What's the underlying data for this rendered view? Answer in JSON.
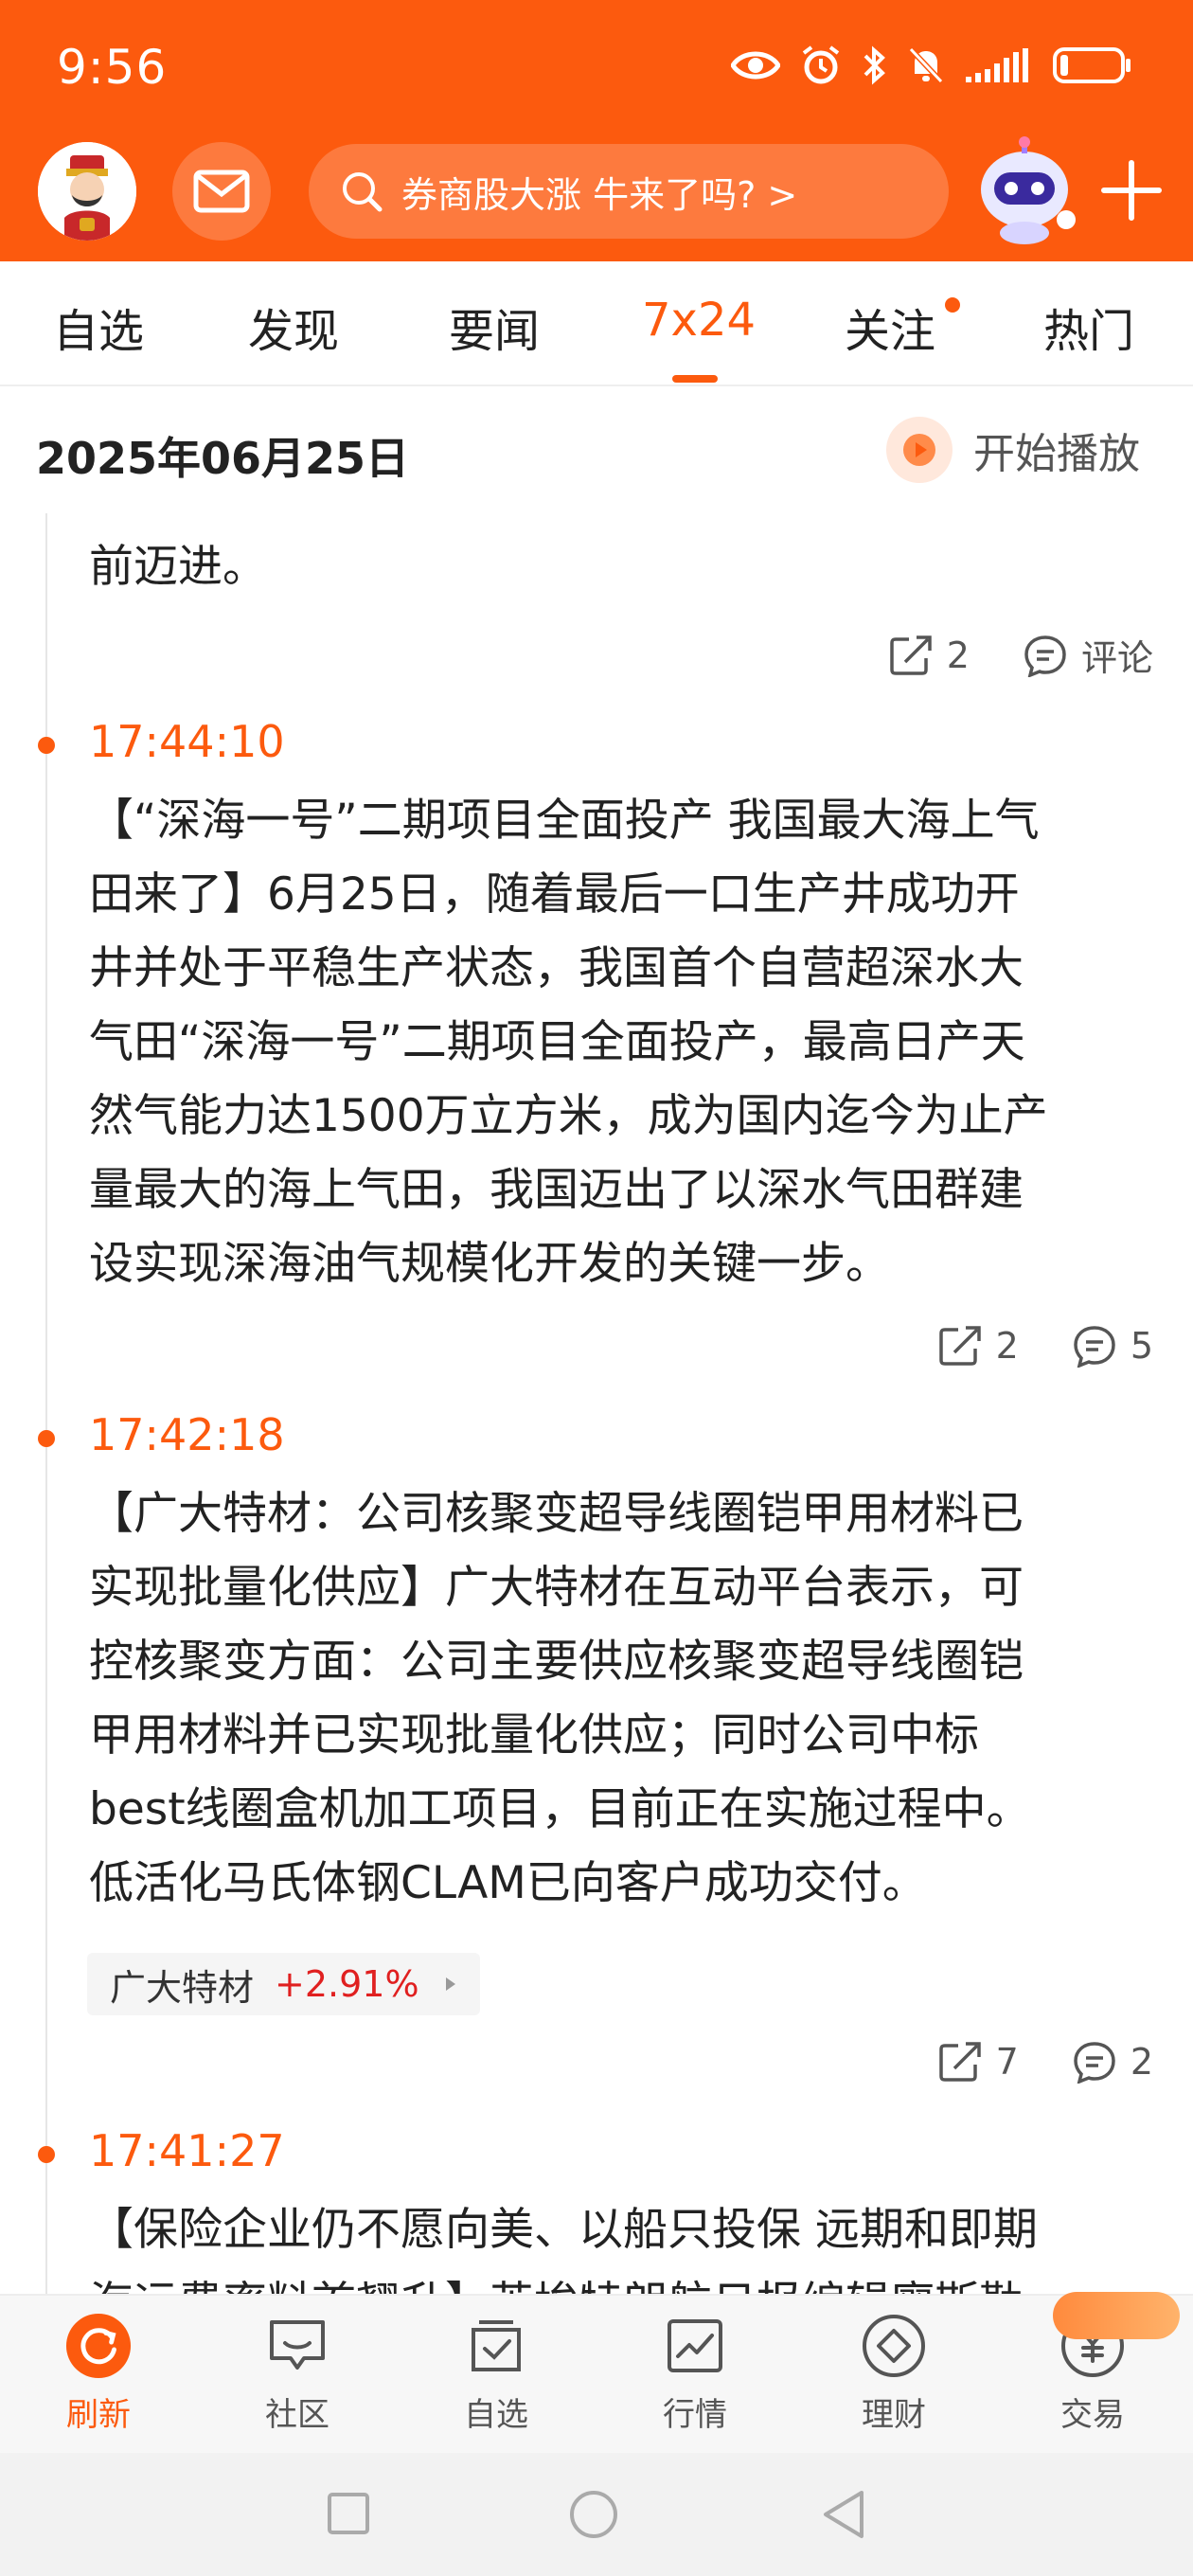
{
  "status_bar": {
    "time": "9:56"
  },
  "header": {
    "search_placeholder": "券商股大涨 牛来了吗? >"
  },
  "tabs": [
    {
      "label": "自选"
    },
    {
      "label": "发现"
    },
    {
      "label": "要闻"
    },
    {
      "label": "7x24"
    },
    {
      "label": "关注"
    },
    {
      "label": "热门"
    }
  ],
  "date_row": {
    "date": "2025年06月25日",
    "play_label": "开始播放"
  },
  "feed": {
    "partial_top": {
      "text": "前迈进。",
      "share_count": "2",
      "comment_label": "评论"
    },
    "items": [
      {
        "time": "17:44:10",
        "lines": [
          "【“深海一号”二期项目全面投产 我国最大海上气",
          "田来了】6月25日，随着最后一口生产井成功开",
          "井并处于平稳生产状态，我国首个自营超深水大",
          "气田“深海一号”二期项目全面投产，最高日产天",
          "然气能力达1500万立方米，成为国内迄今为止产",
          "量最大的海上气田，我国迈出了以深水气田群建",
          "设实现深海油气规模化开发的关键一步。"
        ],
        "share_count": "2",
        "comment_count": "5"
      },
      {
        "time": "17:42:18",
        "lines": [
          "【广大特材：公司核聚变超导线圈铠甲用材料已",
          "实现批量化供应】广大特材在互动平台表示，可",
          "控核聚变方面：公司主要供应核聚变超导线圈铠",
          "甲用材料并已实现批量化供应；同时公司中标",
          "best线圈盒机加工项目，目前正在实施过程中。",
          "低活化马氏体钢CLAM已向客户成功交付。"
        ],
        "stock": {
          "name": "广大特材",
          "change": "+2.91%"
        },
        "share_count": "7",
        "comment_count": "2"
      },
      {
        "time": "17:41:27",
        "lines": [
          "【保险企业仍不愿向美、以船只投保 远期和即期",
          "海运费率料首翘升】英埃特朗航日报编辑廖斯勒"
        ]
      }
    ]
  },
  "bottom_nav": [
    {
      "label": "刷新",
      "icon": "refresh-icon"
    },
    {
      "label": "社区",
      "icon": "chat-icon"
    },
    {
      "label": "自选",
      "icon": "checkbox-icon"
    },
    {
      "label": "行情",
      "icon": "chart-icon"
    },
    {
      "label": "理财",
      "icon": "diamond-icon"
    },
    {
      "label": "交易",
      "icon": "yuan-icon"
    }
  ],
  "colors": {
    "brand": "#fc5a0e",
    "up": "#e02020"
  }
}
